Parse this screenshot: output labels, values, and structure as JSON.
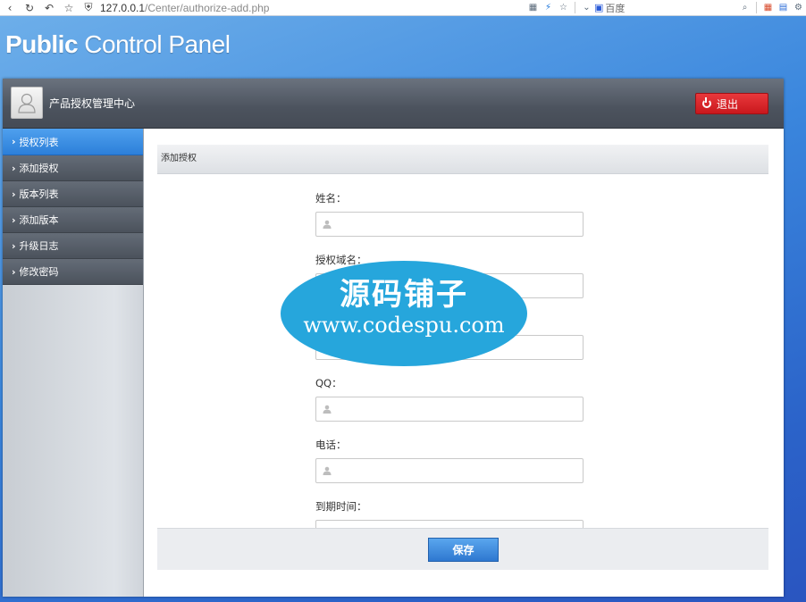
{
  "browser": {
    "url_host": "127.0.0.1",
    "url_path": "/Center/authorize-add.php",
    "search_engine": "百度"
  },
  "brand": {
    "bold": "Public",
    "light": " Control Panel"
  },
  "header": {
    "title": "产品授权管理中心",
    "logout_label": "退出"
  },
  "sidebar": {
    "items": [
      {
        "label": "授权列表"
      },
      {
        "label": "添加授权"
      },
      {
        "label": "版本列表"
      },
      {
        "label": "添加版本"
      },
      {
        "label": "升级日志"
      },
      {
        "label": "修改密码"
      }
    ]
  },
  "content": {
    "heading": "添加授权",
    "fields": [
      {
        "label": "姓名：",
        "value": ""
      },
      {
        "label": "授权域名：",
        "value": ""
      },
      {
        "label": "",
        "value": ""
      },
      {
        "label": "QQ：",
        "value": ""
      },
      {
        "label": "电话：",
        "value": ""
      },
      {
        "label": "到期时间：",
        "value": ""
      }
    ],
    "save_label": "保存"
  },
  "watermark": {
    "line1": "源码铺子",
    "line2": "www.codespu.com"
  },
  "colors": {
    "accent": "#2c7fd9",
    "logout": "#d8262b",
    "watermark": "#26a6dc"
  }
}
